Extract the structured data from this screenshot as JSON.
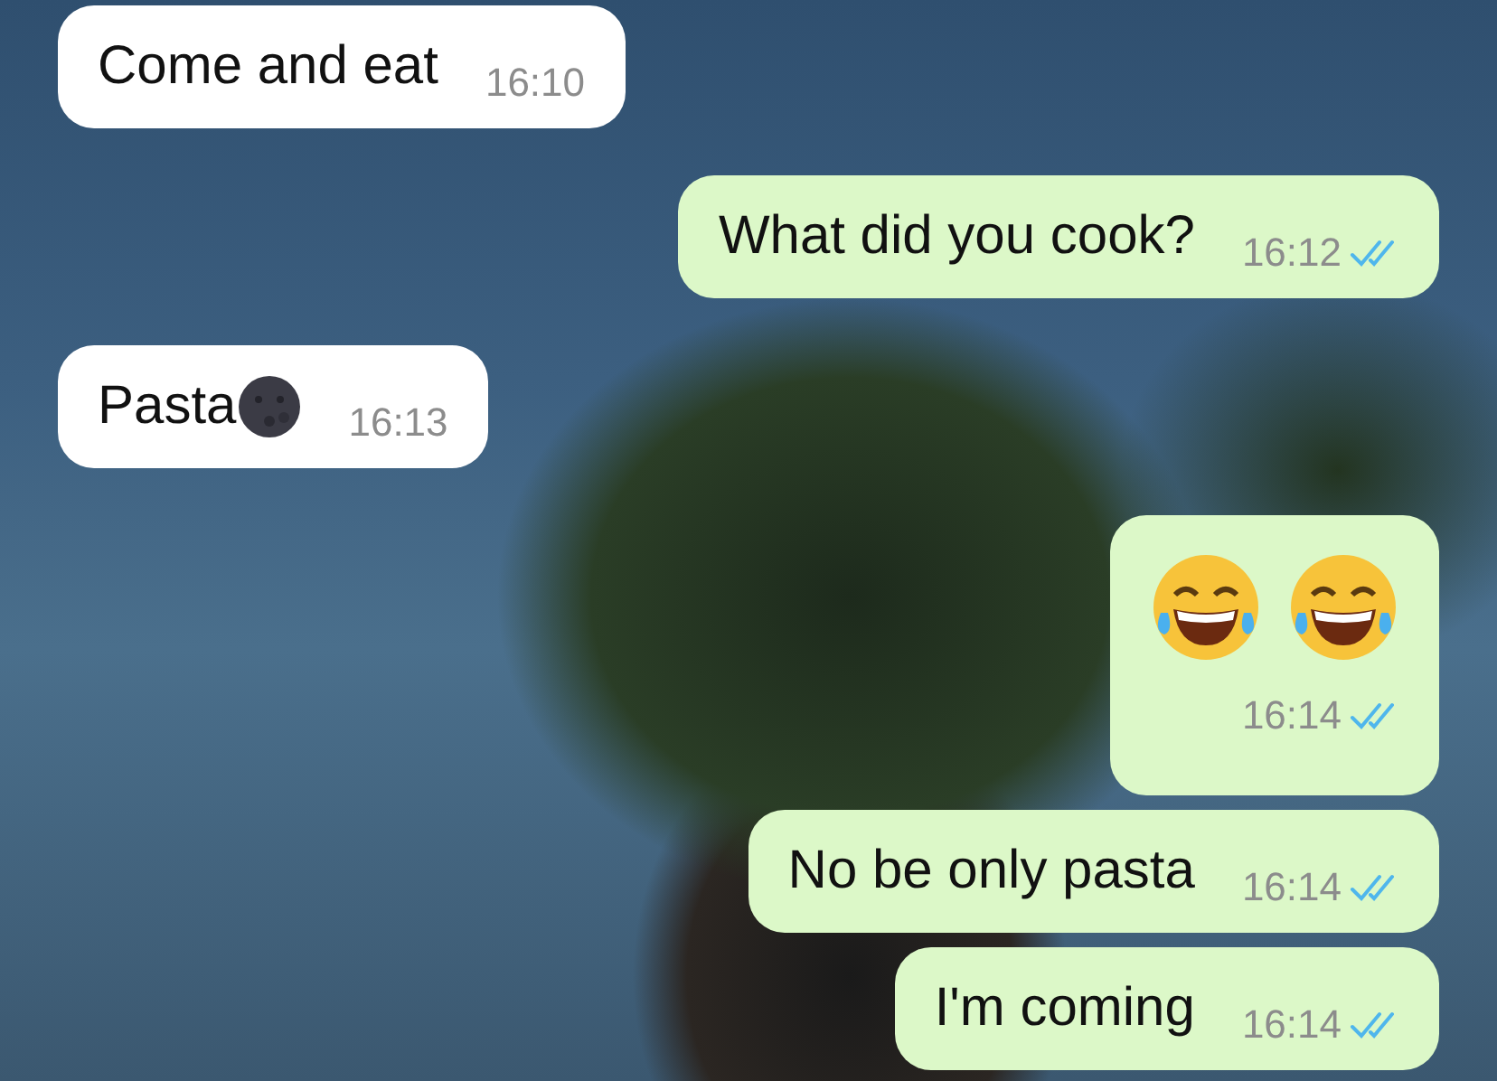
{
  "messages": [
    {
      "kind": "text",
      "outgoing": false,
      "text": "Come and eat",
      "time": "16:10"
    },
    {
      "kind": "text",
      "outgoing": true,
      "text": "What did you cook?",
      "time": "16:12",
      "read": true
    },
    {
      "kind": "text_emoji",
      "outgoing": false,
      "text": "Pasta",
      "time": "16:13"
    },
    {
      "kind": "emoji",
      "outgoing": true,
      "time": "16:14",
      "read": true
    },
    {
      "kind": "text",
      "outgoing": true,
      "text": "No be only pasta",
      "time": "16:14",
      "read": true
    },
    {
      "kind": "text",
      "outgoing": true,
      "text": "I'm coming",
      "time": "16:14",
      "read": true
    }
  ]
}
